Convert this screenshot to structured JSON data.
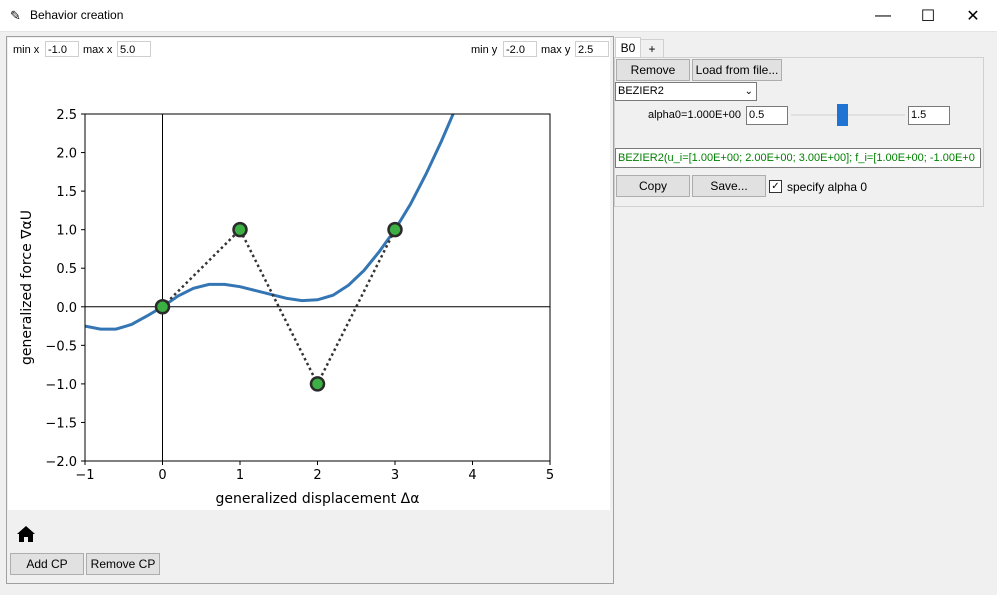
{
  "window": {
    "title": "Behavior creation",
    "minimize": "—",
    "maximize": "☐",
    "close": "✕"
  },
  "range": {
    "min_x_label": "min x",
    "min_x_value": "-1.0",
    "max_x_label": "max x",
    "max_x_value": "5.0",
    "min_y_label": "min y",
    "min_y_value": "-2.0",
    "max_y_label": "max y",
    "max_y_value": "2.5"
  },
  "buttons": {
    "add_cp": "Add CP",
    "remove_cp": "Remove CP",
    "remove": "Remove",
    "load": "Load from file...",
    "copy": "Copy",
    "save": "Save..."
  },
  "tabs": {
    "active": "B0",
    "add": "+"
  },
  "behavior": {
    "type": "BEZIER2",
    "alpha_label": "alpha0=1.000E+00",
    "alpha_value": "0.5",
    "alpha_max": "1.5",
    "slider_fraction": 0.45,
    "expression": "BEZIER2(u_i=[1.00E+00; 2.00E+00; 3.00E+00]; f_i=[1.00E+00; -1.00E+0",
    "specify_alpha_label": "specify alpha 0",
    "specify_alpha_checked": true
  },
  "chart_data": {
    "type": "line",
    "xlabel": "generalized displacement Δα",
    "ylabel": "generalized force ∇αU",
    "xlim": [
      -1,
      5
    ],
    "ylim": [
      -2,
      2.5
    ],
    "xticks": [
      -1,
      0,
      1,
      2,
      3,
      4,
      5
    ],
    "yticks": [
      -2.0,
      -1.5,
      -1.0,
      -0.5,
      0.0,
      0.5,
      1.0,
      1.5,
      2.0,
      2.5
    ],
    "xtick_labels": [
      "−1",
      "0",
      "1",
      "2",
      "3",
      "4",
      "5"
    ],
    "ytick_labels": [
      "−2.0",
      "−1.5",
      "−1.0",
      "−0.5",
      "0.0",
      "0.5",
      "1.0",
      "1.5",
      "2.0",
      "2.5"
    ],
    "grid": false,
    "series": [
      {
        "values": [
          [
            -1.0,
            -0.25
          ],
          [
            -0.8,
            -0.29
          ],
          [
            -0.6,
            -0.29
          ],
          [
            -0.4,
            -0.23
          ],
          [
            -0.2,
            -0.12
          ],
          [
            0.0,
            0.0
          ],
          [
            0.2,
            0.14
          ],
          [
            0.4,
            0.24
          ],
          [
            0.6,
            0.29
          ],
          [
            0.8,
            0.29
          ],
          [
            1.0,
            0.26
          ],
          [
            1.2,
            0.21
          ],
          [
            1.4,
            0.16
          ],
          [
            1.6,
            0.11
          ],
          [
            1.8,
            0.08
          ],
          [
            2.0,
            0.09
          ],
          [
            2.2,
            0.15
          ],
          [
            2.4,
            0.28
          ],
          [
            2.6,
            0.47
          ],
          [
            2.8,
            0.72
          ],
          [
            3.0,
            1.0
          ],
          [
            3.2,
            1.33
          ],
          [
            3.4,
            1.72
          ],
          [
            3.6,
            2.15
          ],
          [
            3.75,
            2.5
          ]
        ]
      }
    ],
    "control_points": [
      [
        0,
        0
      ],
      [
        1,
        1
      ],
      [
        2,
        -1
      ],
      [
        3,
        1
      ]
    ],
    "curve_color": "#3476b4",
    "point_color": "#3cb043"
  }
}
